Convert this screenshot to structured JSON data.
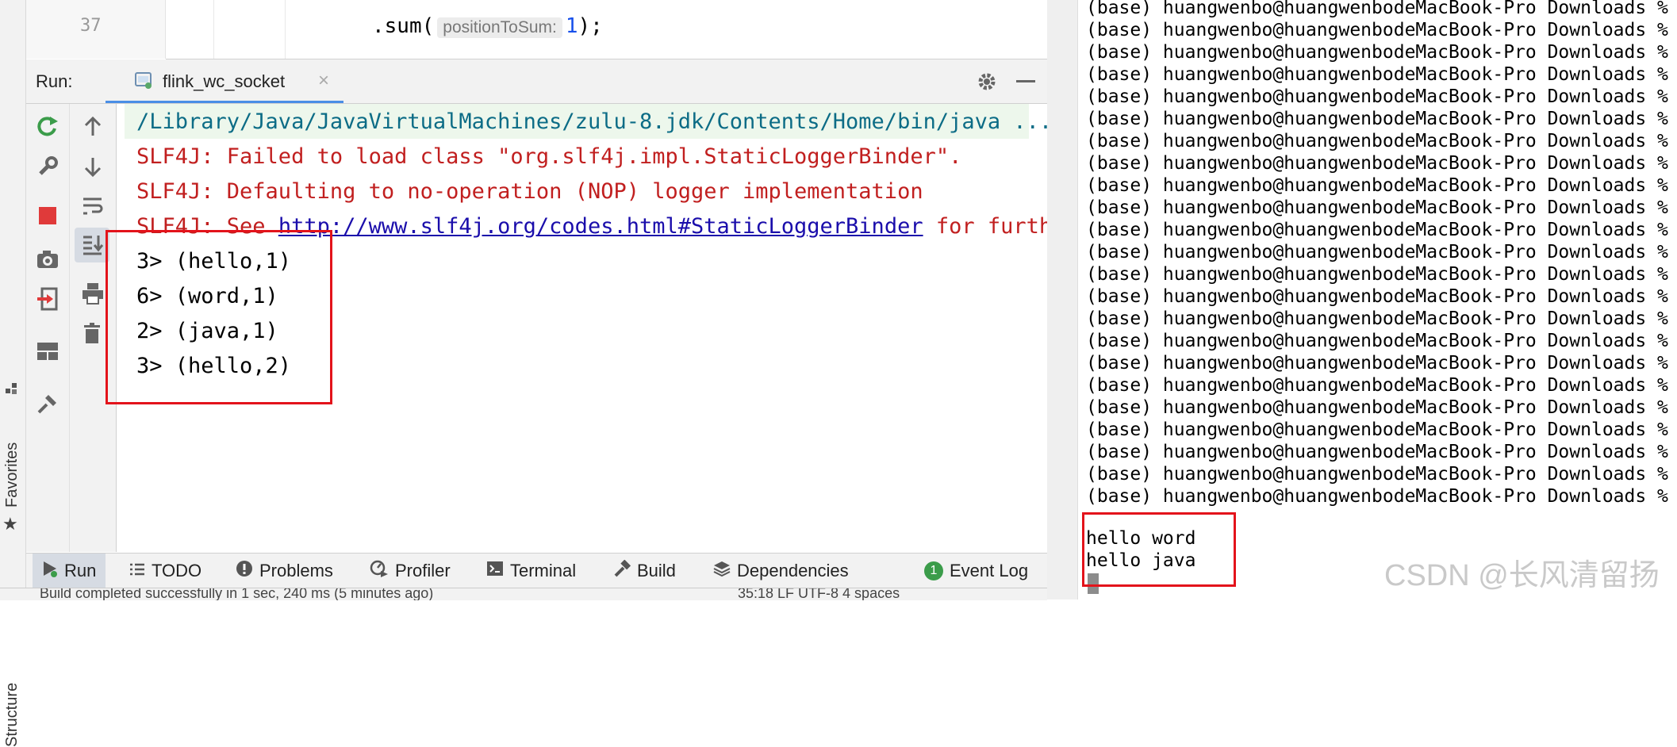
{
  "editor": {
    "line_number": "37",
    "code_prefix": ".sum(",
    "param_hint": "positionToSum:",
    "arg_value": "1",
    "code_suffix": ");"
  },
  "run_panel": {
    "label": "Run:",
    "tab_name": "flink_wc_socket",
    "tab_close": "×",
    "console_lines": [
      {
        "text": "/Library/Java/JavaVirtualMachines/zulu-8.jdk/Contents/Home/bin/java ...",
        "color": "#0c6c86"
      },
      {
        "text": "SLF4J: Failed to load class \"org.slf4j.impl.StaticLoggerBinder\".",
        "color": "#c11f1f"
      },
      {
        "text": "SLF4J: Defaulting to no-operation (NOP) logger implementation",
        "color": "#c11f1f"
      },
      {
        "text": "3> (hello,1)",
        "color": "#000000"
      },
      {
        "text": "6> (word,1)",
        "color": "#000000"
      },
      {
        "text": "2> (java,1)",
        "color": "#000000"
      },
      {
        "text": "3> (hello,2)",
        "color": "#000000"
      }
    ],
    "see_line": {
      "prefix": "SLF4J: See ",
      "link": "http://www.slf4j.org/codes.html#StaticLoggerBinder",
      "suffix": " for further"
    }
  },
  "side_tabs": {
    "structure": "Structure",
    "favorites": "Favorites"
  },
  "bottom_tabs": [
    {
      "label": "Run",
      "icon": "play-icon"
    },
    {
      "label": "TODO",
      "icon": "list-icon"
    },
    {
      "label": "Problems",
      "icon": "alert-icon"
    },
    {
      "label": "Profiler",
      "icon": "profiler-icon"
    },
    {
      "label": "Terminal",
      "icon": "terminal-icon"
    },
    {
      "label": "Build",
      "icon": "hammer-icon"
    },
    {
      "label": "Dependencies",
      "icon": "layers-icon"
    },
    {
      "label": "Event Log",
      "icon": "event-log-icon",
      "badge": "1"
    }
  ],
  "status_bar": {
    "left": "Build completed successfully in 1 sec, 240 ms (5 minutes ago)",
    "right": "35:18   LF   UTF-8   4 spaces"
  },
  "terminal": {
    "prompt_line": "(base) huangwenbo@huangwenbodeMacBook-Pro Downloads %",
    "prompt_repeat": 23,
    "input_lines": [
      "hello word",
      "hello java"
    ]
  },
  "watermark": "CSDN @长风清留扬",
  "colors": {
    "error_red": "#c11f1f",
    "path_teal": "#0c6c86",
    "link_blue": "#1a0dab",
    "highlight_box": "#e3131b"
  }
}
